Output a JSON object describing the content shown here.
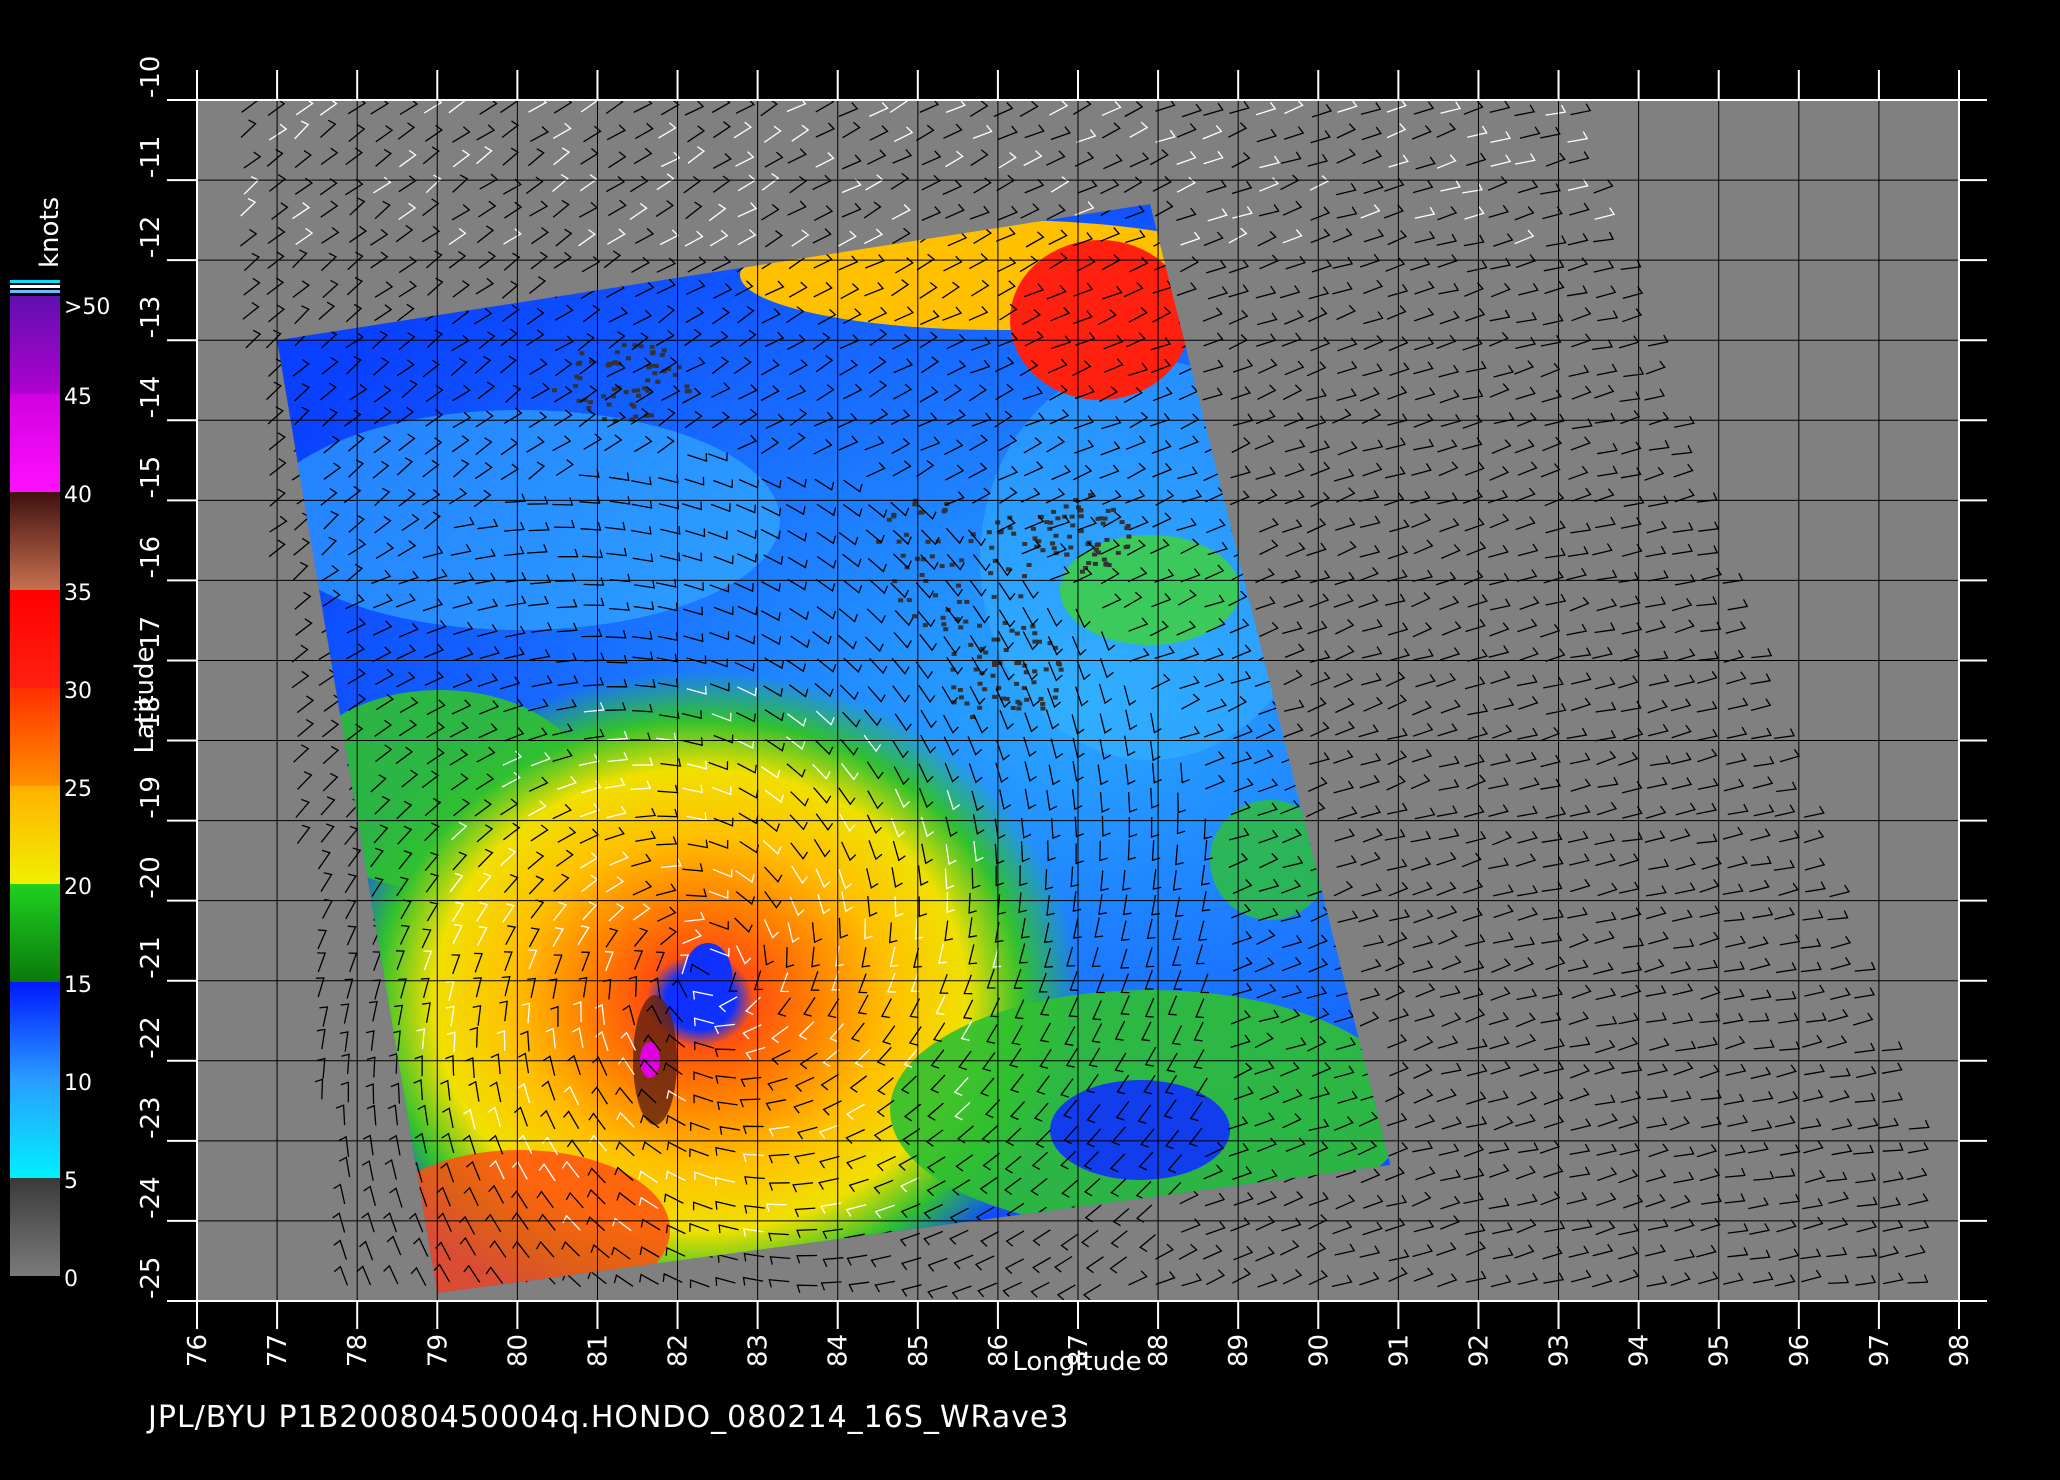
{
  "colorbar": {
    "unit_label": "knots",
    "tick_labels": [
      ">50",
      "45",
      "40",
      "35",
      "30",
      "25",
      "20",
      "15",
      "10",
      "5",
      "0"
    ],
    "stops": [
      {
        "from": 0,
        "to": 5,
        "colors": [
          "#7a7a7a",
          "#3a3a3a"
        ]
      },
      {
        "from": 5,
        "to": 10,
        "colors": [
          "#00f0ff",
          "#2a9dff"
        ]
      },
      {
        "from": 10,
        "to": 15,
        "colors": [
          "#2a9dff",
          "#0018ff"
        ]
      },
      {
        "from": 15,
        "to": 20,
        "colors": [
          "#0a7a0a",
          "#20d020"
        ]
      },
      {
        "from": 20,
        "to": 25,
        "colors": [
          "#f0f000",
          "#ffb000"
        ]
      },
      {
        "from": 25,
        "to": 30,
        "colors": [
          "#ff9000",
          "#ff3000"
        ]
      },
      {
        "from": 30,
        "to": 35,
        "colors": [
          "#ff2010",
          "#ff0000"
        ]
      },
      {
        "from": 35,
        "to": 40,
        "colors": [
          "#c87050",
          "#401010"
        ]
      },
      {
        "from": 40,
        "to": 45,
        "colors": [
          "#ff10ff",
          "#d000e0"
        ]
      },
      {
        "from": 45,
        "to": 50,
        "colors": [
          "#b000d0",
          "#6010b0"
        ]
      }
    ]
  },
  "map": {
    "x_axis_label": "Longitude",
    "y_axis_label": "Latitude",
    "lon_range": [
      76,
      98
    ],
    "lat_range": [
      -25,
      -10
    ],
    "lon_ticks": [
      "76",
      "77",
      "78",
      "79",
      "80",
      "81",
      "82",
      "83",
      "84",
      "85",
      "86",
      "87",
      "88",
      "89",
      "90",
      "91",
      "92",
      "93",
      "94",
      "95",
      "96",
      "97",
      "98"
    ],
    "lat_ticks": [
      "-10",
      "-11",
      "-12",
      "-13",
      "-14",
      "-15",
      "-16",
      "-17",
      "-18",
      "-19",
      "-20",
      "-21",
      "-22",
      "-23",
      "-24",
      "-25"
    ],
    "grid": true,
    "background_color": "#808080",
    "swath_corners_lonlat": [
      [
        77.0,
        -13.0
      ],
      [
        87.9,
        -11.3
      ],
      [
        90.9,
        -23.3
      ],
      [
        79.0,
        -24.9
      ]
    ],
    "cyclone_eye_lonlat": [
      82.4,
      -20.9
    ]
  },
  "footer": {
    "caption": "JPL/BYU  P1B20080450004q.HONDO_080214_16S_WRave3"
  }
}
